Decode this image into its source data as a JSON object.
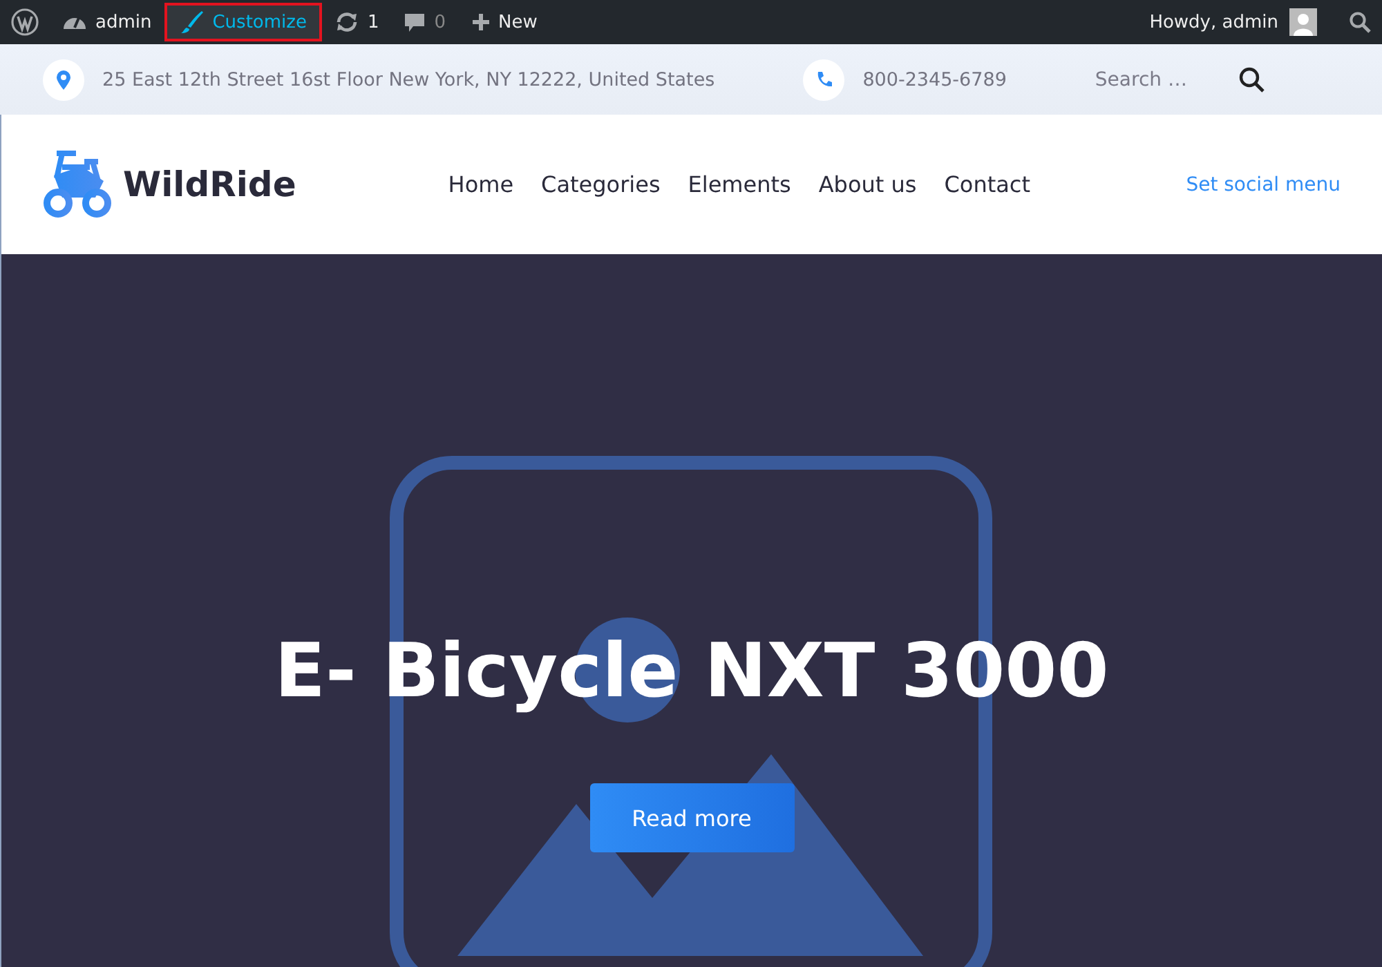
{
  "admin_bar": {
    "items": [
      {
        "kind": "wp"
      },
      {
        "kind": "dashboard",
        "label": "admin"
      },
      {
        "kind": "customize",
        "label": "Customize",
        "highlighted": true
      },
      {
        "kind": "updates",
        "label": "1"
      },
      {
        "kind": "comments",
        "label": "0"
      },
      {
        "kind": "new",
        "label": "New"
      }
    ],
    "greeting": "Howdy, admin"
  },
  "info_bar": {
    "address": "25 East 12th Street 16st Floor New York, NY 12222, United States",
    "phone": "800-2345-6789",
    "search": {
      "placeholder": "Search …"
    }
  },
  "header": {
    "logo": "WildRide",
    "nav": [
      {
        "label": "Home"
      },
      {
        "label": "Categories"
      },
      {
        "label": "Elements"
      },
      {
        "label": "About us"
      },
      {
        "label": "Contact"
      }
    ],
    "social_link": "Set social menu"
  },
  "hero": {
    "title": "E- Bicycle NXT 3000",
    "button": "Read more"
  }
}
